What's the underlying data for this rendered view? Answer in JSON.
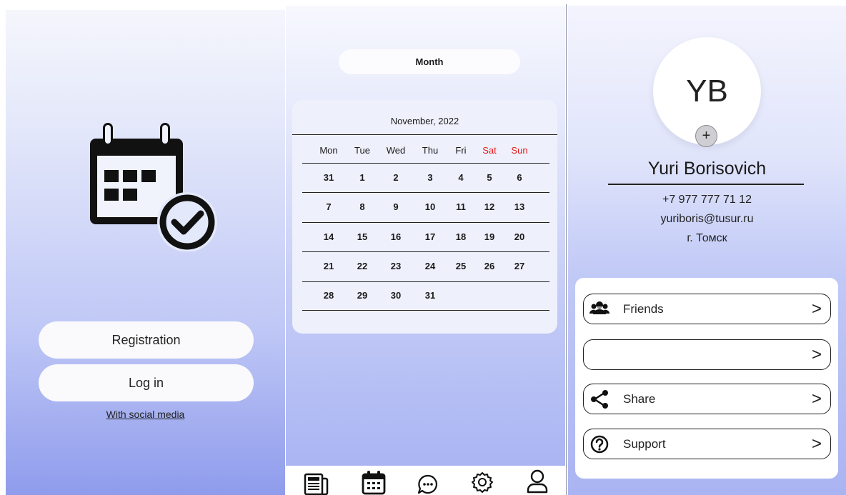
{
  "login": {
    "registration_label": "Registration",
    "login_label": "Log in",
    "social_label": "With social media",
    "logo_icon": "calendar-check-icon"
  },
  "calendar": {
    "view_label": "Month",
    "title": "November, 2022",
    "weekdays": [
      "Mon",
      "Tue",
      "Wed",
      "Thu",
      "Fri",
      "Sat",
      "Sun"
    ],
    "weekend_color": "#e81b1b",
    "weeks": [
      [
        "31",
        "1",
        "2",
        "3",
        "4",
        "5",
        "6"
      ],
      [
        "7",
        "8",
        "9",
        "10",
        "11",
        "12",
        "13"
      ],
      [
        "14",
        "15",
        "16",
        "17",
        "18",
        "19",
        "20"
      ],
      [
        "21",
        "22",
        "23",
        "24",
        "25",
        "26",
        "27"
      ],
      [
        "28",
        "29",
        "30",
        "31",
        "",
        "",
        ""
      ]
    ],
    "nav_icons": [
      "news-icon",
      "calendar-icon",
      "chat-icon",
      "settings-icon",
      "profile-icon"
    ]
  },
  "profile": {
    "initials": "YB",
    "add_label": "+",
    "name": "Yuri Borisovich",
    "phone": "+7 977 777 71 12",
    "email": "yuriboris@tusur.ru",
    "city": "г. Томск",
    "menu": [
      {
        "label": "Friends",
        "icon": "friends-icon"
      },
      {
        "label": "",
        "icon": ""
      },
      {
        "label": "Share",
        "icon": "share-icon"
      },
      {
        "label": "Support",
        "icon": "help-icon"
      }
    ],
    "arrow": ">"
  }
}
